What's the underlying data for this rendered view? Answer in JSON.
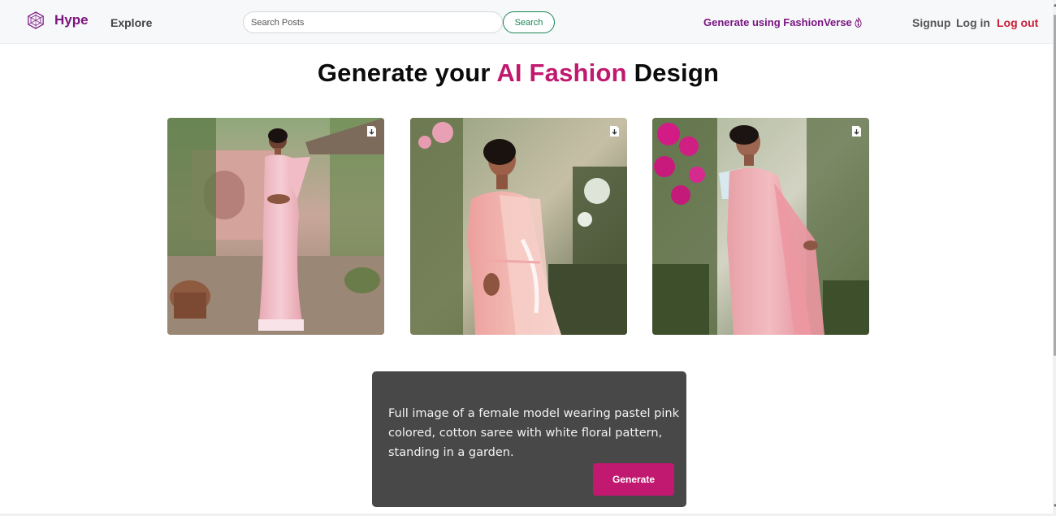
{
  "navbar": {
    "brand": "Hype",
    "explore": "Explore",
    "search_placeholder": "Search Posts",
    "search_button": "Search",
    "generate_link": "Generate using FashionVerse",
    "signup": "Signup",
    "login": "Log in",
    "logout": "Log out"
  },
  "heading": {
    "prefix": "Generate your ",
    "accent": "AI Fashion",
    "suffix": " Design"
  },
  "images": [
    {
      "icon": "download-icon"
    },
    {
      "icon": "download-icon"
    },
    {
      "icon": "download-icon"
    }
  ],
  "prompt": {
    "text": "Full image of a female model wearing pastel pink colored, cotton saree with white floral pattern, standing in a garden.",
    "generate_button": "Generate"
  },
  "colors": {
    "brand": "#7a1580",
    "accent": "#c0196f",
    "search_green": "#198754",
    "logout_red": "#c81e36",
    "prompt_bg": "#484848"
  }
}
